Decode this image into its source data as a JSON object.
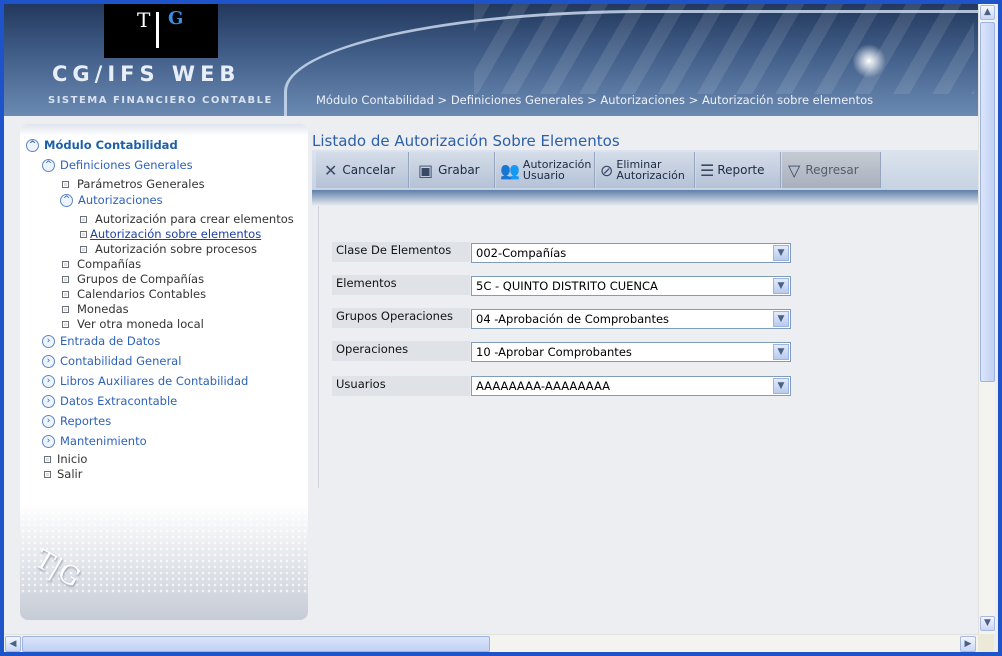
{
  "header": {
    "logo_left": "T",
    "logo_right": "G",
    "app_title": "CG/IFS WEB",
    "app_subtitle": "SISTEMA FINANCIERO CONTABLE",
    "breadcrumb": "Módulo Contabilidad > Definiciones Generales > Autorizaciones > Autorización sobre elementos"
  },
  "sidebar": {
    "root": "Módulo Contabilidad",
    "definiciones": "Definiciones Generales",
    "parametros": "Parámetros Generales",
    "autorizaciones": "Autorizaciones",
    "auth_crear": "Autorización para crear elementos",
    "auth_elementos": "Autorización sobre elementos",
    "auth_procesos": "Autorización sobre procesos",
    "companias": "Compañías",
    "grupos_companias": "Grupos de Compañías",
    "calendarios": "Calendarios Contables",
    "monedas": "Monedas",
    "moneda_local": "Ver otra moneda local",
    "entrada": "Entrada de Datos",
    "contabilidad": "Contabilidad General",
    "libros": "Libros Auxiliares de Contabilidad",
    "extracontable": "Datos Extracontable",
    "reportes": "Reportes",
    "mantenimiento": "Mantenimiento",
    "inicio": "Inicio",
    "salir": "Salir",
    "footer_logo": "T|G"
  },
  "main": {
    "title": "Listado de Autorización Sobre Elementos"
  },
  "toolbar": {
    "cancelar": "Cancelar",
    "grabar": "Grabar",
    "aut_usuario_1": "Autorización",
    "aut_usuario_2": "Usuario",
    "eliminar_1": "Eliminar",
    "eliminar_2": "Autorización",
    "reporte": "Reporte",
    "regresar": "Regresar"
  },
  "form": {
    "clase_label": "Clase De Elementos",
    "clase_value": "002-Compañías",
    "elementos_label": "Elementos",
    "elementos_value": "5C - QUINTO DISTRITO CUENCA",
    "grupos_label": "Grupos Operaciones",
    "grupos_value": "04 -Aprobación de Comprobantes",
    "operaciones_label": "Operaciones",
    "operaciones_value": "10 -Aprobar Comprobantes",
    "usuarios_label": "Usuarios",
    "usuarios_value": "AAAAAAAA-AAAAAAAA"
  }
}
